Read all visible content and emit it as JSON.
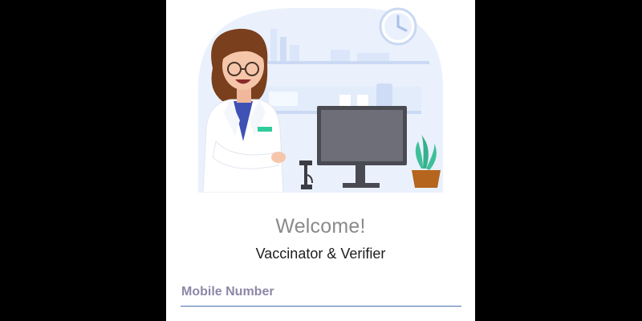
{
  "welcome": {
    "title": "Welcome!",
    "subtitle": "Vaccinator & Verifier"
  },
  "login": {
    "mobile_placeholder": "Mobile Number",
    "mobile_value": ""
  },
  "colors": {
    "accent": "#4a6fb0",
    "placeholder": "#8e87a8",
    "scene_background": "#eaf1fd",
    "scrub_top": "#ffffff",
    "scrub_inner": "#3f51b5",
    "name_badge": "#2ecc9a",
    "plant": "#3fbf9a",
    "pot": "#b5651d"
  },
  "illustration": {
    "subject": "doctor-at-desk",
    "icons": [
      "clock-icon",
      "computer-monitor-icon",
      "plant-icon",
      "microscope-icon"
    ]
  }
}
